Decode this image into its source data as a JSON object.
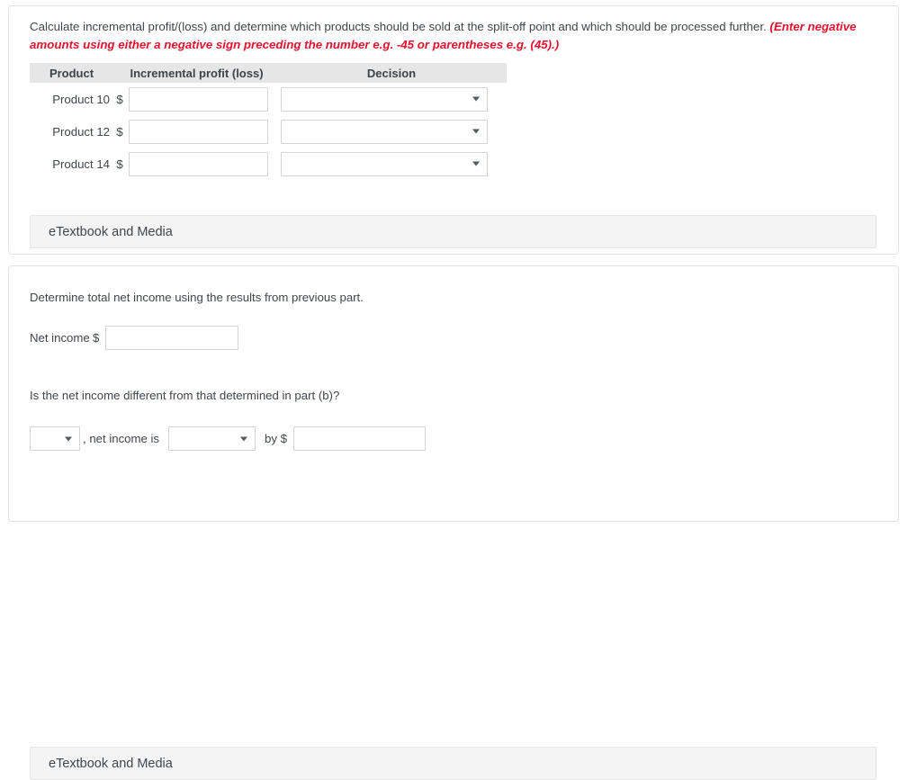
{
  "card_a": {
    "instruction_main": "Calculate incremental profit/(loss) and determine which products should be sold at the split-off point and which should be processed further.",
    "instruction_emphasis": "(Enter negative amounts using either a negative sign preceding the number e.g. -45 or parentheses e.g. (45).)",
    "table": {
      "headers": {
        "product": "Product",
        "profit": "Incremental profit (loss)",
        "decision": "Decision"
      },
      "currency_symbol": "$",
      "rows": [
        {
          "label": "Product 10",
          "currency": "$",
          "profit_value": "",
          "profit_placeholder": "",
          "decision_value": ""
        },
        {
          "label": "Product 12",
          "currency": "$",
          "profit_value": "",
          "profit_placeholder": "",
          "decision_value": ""
        },
        {
          "label": "Product 14",
          "currency": "$",
          "profit_value": "",
          "profit_placeholder": "",
          "decision_value": ""
        }
      ]
    },
    "etextbook_label": "eTextbook and Media"
  },
  "card_b": {
    "net_income_question": "Determine total net income using the results from previous part.",
    "net_income_label": "Net income",
    "net_income_currency": "$",
    "net_income_value": "",
    "difference_question": "Is the net income different from that determined in part (b)?",
    "yesno_value": "",
    "middle_text": ", net income is",
    "direction_value": "",
    "by_text": "by $",
    "amount_value": "",
    "etextbook_label": "eTextbook and Media"
  },
  "icons": {
    "dropdown_arrow": "chevron-down-icon"
  },
  "colors": {
    "emphasis_red": "#e8112d",
    "text": "#41464b",
    "header_band": "#e6e6e6",
    "etextbook_bg": "#f4f4f4",
    "card_border": "#e3e3e3",
    "input_border": "#d4d4d4"
  }
}
